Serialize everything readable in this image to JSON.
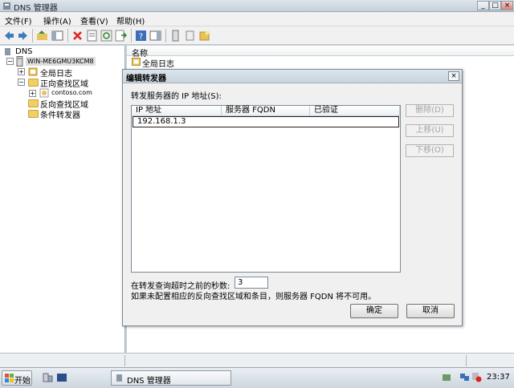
{
  "window": {
    "title": "DNS 管理器"
  },
  "menu": [
    "文件(F)",
    "操作(A)",
    "查看(V)",
    "帮助(H)"
  ],
  "tree": {
    "root": "DNS",
    "server": "WIN-ME6GMU3KCM8",
    "global_logs": "全局日志",
    "forward_zones": "正向查找区域",
    "zone": "contoso.com",
    "reverse_zones": "反向查找区域",
    "conditional_forwarders": "条件转发器"
  },
  "rightpane": {
    "column_name": "名称",
    "row": "全局日志"
  },
  "dialog": {
    "title": "编辑转发器",
    "section_label": "转发服务器的 IP 地址(S):",
    "columns": [
      "IP 地址",
      "服务器 FQDN",
      "已验证"
    ],
    "entry_value": "192.168.1.3",
    "buttons": {
      "delete": "删除(D)",
      "up": "上移(U)",
      "down": "下移(O)",
      "ok": "确定",
      "cancel": "取消"
    },
    "timeout_label": "在转发查询超时之前的秒数:",
    "timeout_value": "3",
    "note": "如果未配置相应的反向查找区域和条目，则服务器 FQDN 将不可用。"
  },
  "taskbar": {
    "start": "开始",
    "task": "DNS 管理器",
    "clock": "23:37"
  }
}
